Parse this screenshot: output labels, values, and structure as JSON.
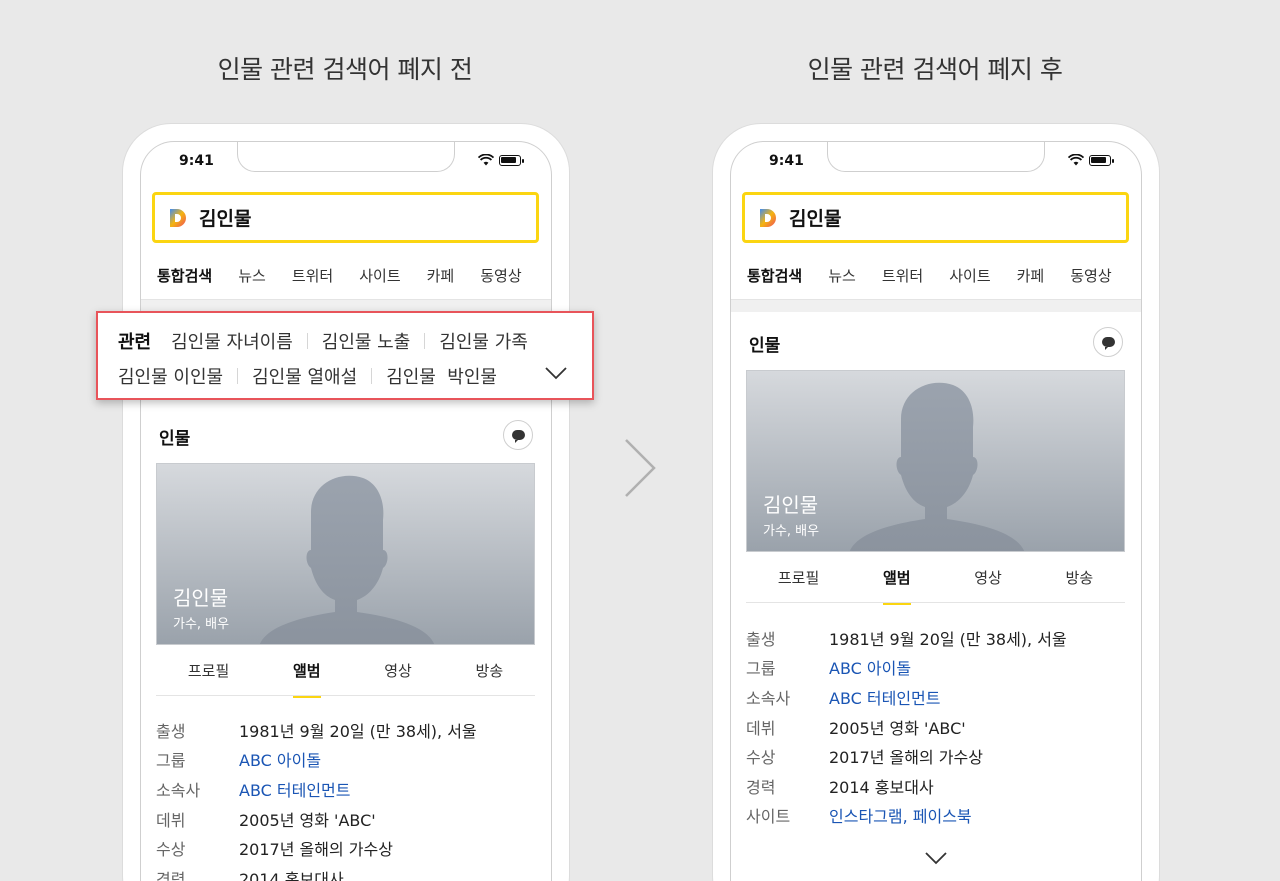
{
  "captions": {
    "before": "인물 관련 검색어 폐지 전",
    "after": "인물 관련 검색어 폐지 후"
  },
  "status": {
    "time": "9:41"
  },
  "search": {
    "query": "김인물"
  },
  "tabs": [
    "통합검색",
    "뉴스",
    "트위터",
    "사이트",
    "카페",
    "동영상"
  ],
  "related": {
    "title": "관련",
    "row1": [
      "김인물 자녀이름",
      "김인물 노출",
      "김인물 가족"
    ],
    "row2": [
      "김인물 이인물",
      "김인물 열애설",
      "김인물  박인물"
    ]
  },
  "person": {
    "section_title": "인물",
    "name": "김인물",
    "role": "가수, 배우",
    "sub_tabs": [
      "프로필",
      "앨범",
      "영상",
      "방송"
    ],
    "active_sub_tab": 1,
    "info": [
      {
        "label": "출생",
        "value": "1981년 9월 20일 (만 38세), 서울",
        "link": false
      },
      {
        "label": "그룹",
        "value": "ABC 아이돌",
        "link": true
      },
      {
        "label": "소속사",
        "value": "ABC 터테인먼트",
        "link": true
      },
      {
        "label": "데뷔",
        "value": "2005년 영화 'ABC'",
        "link": false
      },
      {
        "label": "수상",
        "value": "2017년 올해의 가수상",
        "link": false
      },
      {
        "label": "경력",
        "value": "2014 홍보대사",
        "link": false
      },
      {
        "label": "사이트",
        "value": "인스타그램, 페이스북",
        "link": true
      }
    ]
  },
  "colors": {
    "accent": "#fbd511",
    "highlight_border": "#e8545a",
    "link": "#1a55b4"
  }
}
